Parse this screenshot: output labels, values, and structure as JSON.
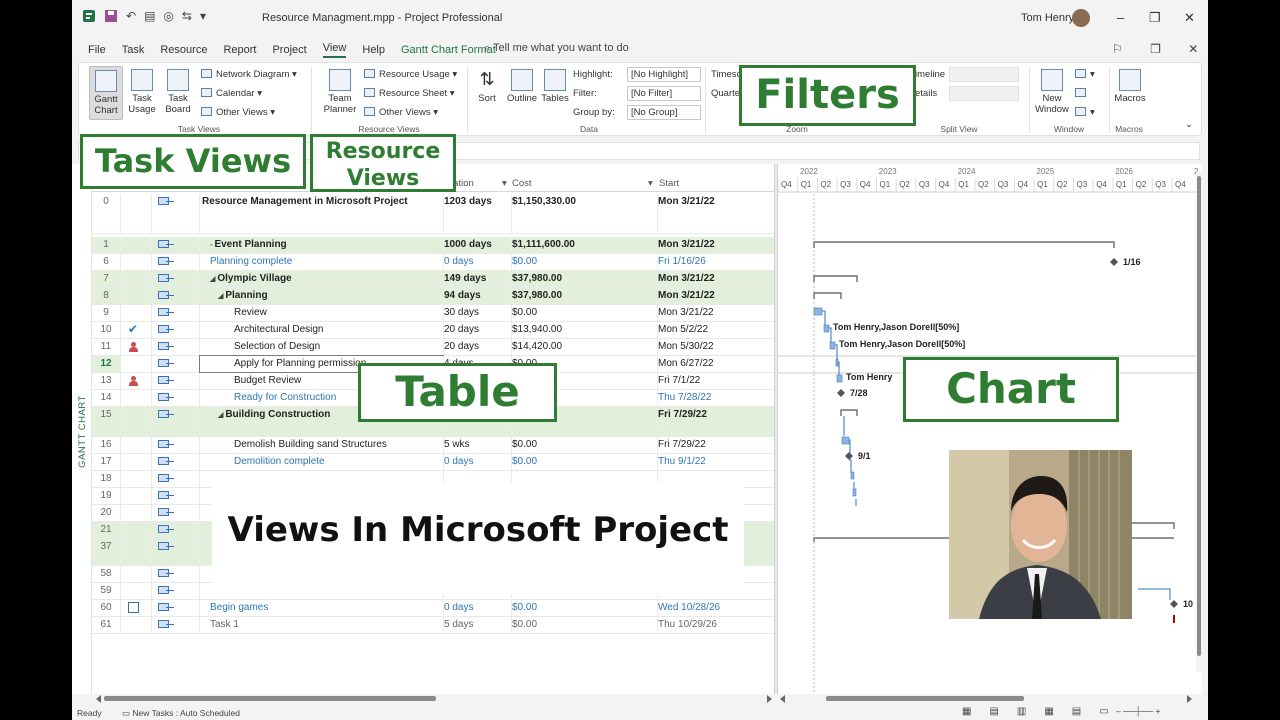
{
  "titlebar": {
    "file_title": "Resource Managment.mpp",
    "separator": "-",
    "app_name": "Project Professional",
    "user_name": "Tom Henry"
  },
  "tabs": [
    "File",
    "Task",
    "Resource",
    "Report",
    "Project",
    "View",
    "Help",
    "Gantt Chart Format"
  ],
  "active_tab": "View",
  "tell_me": "Tell me what you want to do",
  "ribbon": {
    "gantt_chart": "Gantt Chart",
    "task_usage": "Task Usage",
    "task_board": "Task Board",
    "network_diagram": "Network Diagram",
    "calendar": "Calendar",
    "other_views": "Other Views",
    "task_views_group": "Task Views",
    "team_planner": "Team Planner",
    "resource_usage": "Resource Usage",
    "resource_sheet": "Resource Sheet",
    "other_views_2": "Other Views",
    "resource_views_group": "Resource Views",
    "sort": "Sort",
    "outline": "Outline",
    "tables": "Tables",
    "highlight_label": "Highlight:",
    "highlight_value": "[No Highlight]",
    "filter_label": "Filter:",
    "filter_value": "[No Filter]",
    "group_label": "Group by:",
    "group_value": "[No Group]",
    "data_group": "Data",
    "timescale": "Timesc",
    "quarters": "Quarte",
    "zoom_group": "Zoom",
    "timeline": "imeline",
    "details": "etails",
    "split_view_group": "Split View",
    "new_window": "New Window",
    "window_group": "Window",
    "macros": "Macros",
    "macros_group": "Macros"
  },
  "view_label": "GANTT CHART",
  "table": {
    "columns": {
      "duration": "ration",
      "cost": "Cost",
      "start": "Start"
    },
    "rows": [
      {
        "id": "0",
        "name": "Resource Management in Microsoft Project",
        "duration": "1203 days",
        "cost": "$1,150,330.00",
        "start": "Mon 3/21/22"
      },
      {
        "id": "1",
        "name": "Event Planning",
        "duration": "1000 days",
        "cost": "$1,111,600.00",
        "start": "Mon 3/21/22"
      },
      {
        "id": "6",
        "name": "Planning complete",
        "duration": "0 days",
        "cost": "$0.00",
        "start": "Fri 1/16/26"
      },
      {
        "id": "7",
        "name": "Olympic Village",
        "duration": "149 days",
        "cost": "$37,980.00",
        "start": "Mon 3/21/22"
      },
      {
        "id": "8",
        "name": "Planning",
        "duration": "94 days",
        "cost": "$37,980.00",
        "start": "Mon 3/21/22"
      },
      {
        "id": "9",
        "name": "Review",
        "duration": "30 days",
        "cost": "$0.00",
        "start": "Mon 3/21/22"
      },
      {
        "id": "10",
        "name": "Architectural Design",
        "duration": "20 days",
        "cost": "$13,940.00",
        "start": "Mon 5/2/22"
      },
      {
        "id": "11",
        "name": "Selection of Design",
        "duration": "20 days",
        "cost": "$14,420.00",
        "start": "Mon 5/30/22"
      },
      {
        "id": "12",
        "name": "Apply for Planning permission",
        "duration": "4 days",
        "cost": "$0.00",
        "start": "Mon 6/27/22"
      },
      {
        "id": "13",
        "name": "Budget Review",
        "duration": "",
        "cost": "",
        "start": "Fri 7/1/22"
      },
      {
        "id": "14",
        "name": "Ready for Construction",
        "duration": "",
        "cost": "",
        "start": "Thu 7/28/22"
      },
      {
        "id": "15",
        "name": "Building Construction",
        "duration": "",
        "cost": "",
        "start": "Fri 7/29/22"
      },
      {
        "id": "16",
        "name": "Demolish Building sand Structures",
        "duration": "5 wks",
        "cost": "$0.00",
        "start": "Fri 7/29/22"
      },
      {
        "id": "17",
        "name": "Demolition complete",
        "duration": "0 days",
        "cost": "$0.00",
        "start": "Thu 9/1/22"
      },
      {
        "id": "18",
        "name": "",
        "duration": "",
        "cost": "",
        "start": ""
      },
      {
        "id": "19",
        "name": "",
        "duration": "",
        "cost": "",
        "start": ""
      },
      {
        "id": "20",
        "name": "",
        "duration": "",
        "cost": "",
        "start": ""
      },
      {
        "id": "21",
        "name": "",
        "duration": "",
        "cost": "",
        "start": ""
      },
      {
        "id": "37",
        "name": "",
        "duration": "",
        "cost": "",
        "start": ""
      },
      {
        "id": "58",
        "name": "",
        "duration": "",
        "cost": "",
        "start": ""
      },
      {
        "id": "59",
        "name": "",
        "duration": "",
        "cost": "",
        "start": ""
      },
      {
        "id": "60",
        "name": "Begin games",
        "duration": "0 days",
        "cost": "$0.00",
        "start": "Wed 10/28/26"
      },
      {
        "id": "61",
        "name": "Task 1",
        "duration": "5 days",
        "cost": "$0.00",
        "start": "Thu 10/29/26"
      }
    ]
  },
  "chart": {
    "years": [
      "2022",
      "2023",
      "2024",
      "2025",
      "2026",
      "2"
    ],
    "quarters": [
      "Q4",
      "Q1",
      "Q2",
      "Q3",
      "Q4",
      "Q1",
      "Q2",
      "Q3",
      "Q4",
      "Q1",
      "Q2",
      "Q3",
      "Q4",
      "Q1",
      "Q2",
      "Q3",
      "Q4",
      "Q1",
      "Q2",
      "Q3",
      "Q4"
    ],
    "labels": {
      "planning_complete": "1/16",
      "arch_resources": "Tom Henry,Jason Dorell[50%]",
      "sel_resources": "Tom Henry,Jason Dorell[50%]",
      "budget_resource": "Tom Henry",
      "ready_date": "7/28",
      "demolition_date": "9/1",
      "begin_games": "10"
    }
  },
  "callouts": {
    "task_views": "Task Views",
    "resource_views_1": "Resource",
    "resource_views_2": "Views",
    "filters": "Filters",
    "table": "Table",
    "chart": "Chart"
  },
  "banner": "Views In Microsoft Project",
  "status": {
    "ready": "Ready",
    "new_tasks": "New Tasks : Auto Scheduled"
  }
}
